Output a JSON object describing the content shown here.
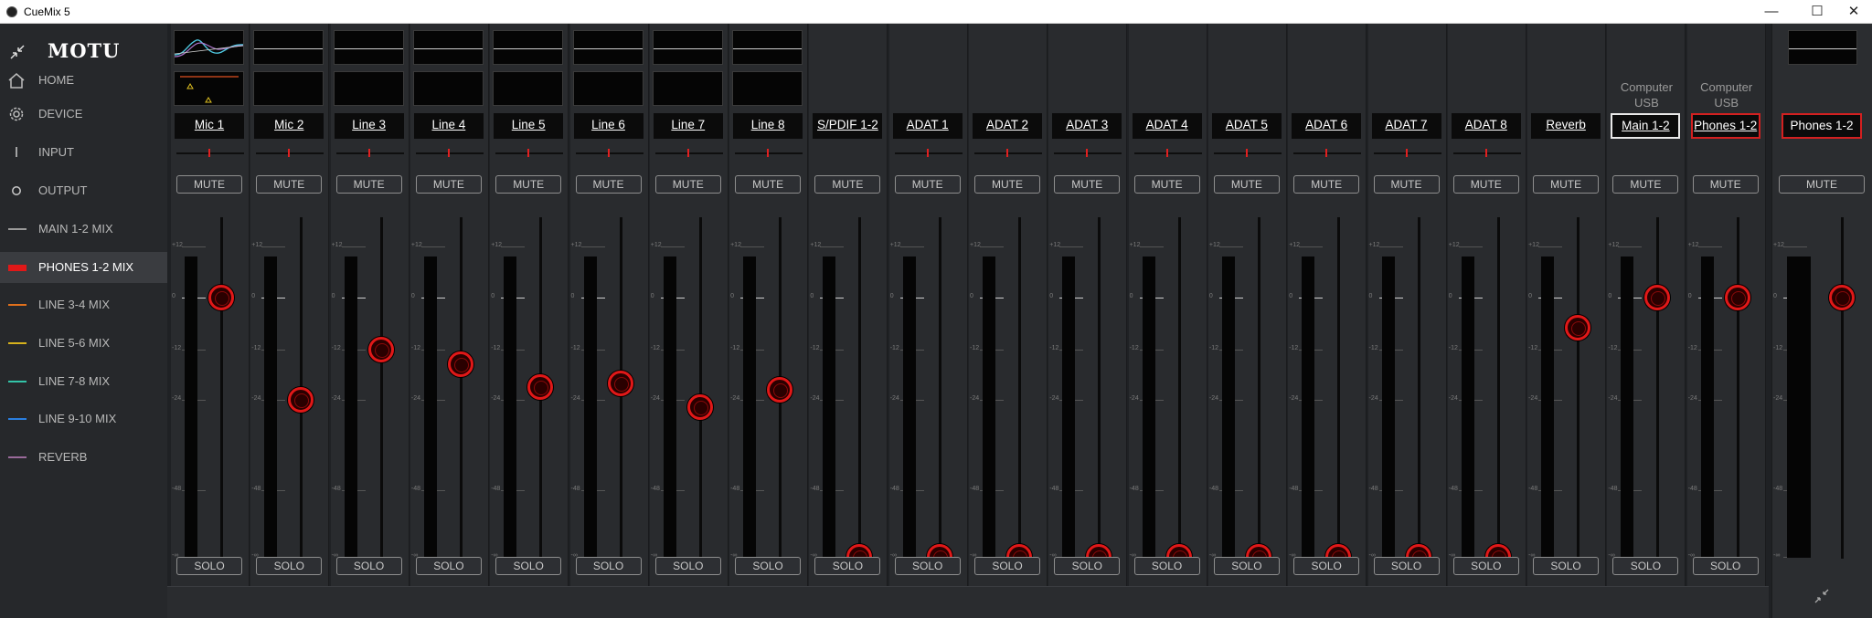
{
  "window": {
    "title": "CueMix 5",
    "minimize": "—",
    "maximize": "☐",
    "close": "✕"
  },
  "logo": "MOTU",
  "nav": [
    {
      "label": "HOME",
      "icon": "home-icon"
    },
    {
      "label": "DEVICE",
      "icon": "gear-icon"
    },
    {
      "label": "INPUT",
      "icon": "input-icon"
    },
    {
      "label": "OUTPUT",
      "icon": "output-icon"
    },
    {
      "label": "MAIN 1-2 MIX",
      "color": "#9a9a9a"
    },
    {
      "label": "PHONES 1-2 MIX",
      "color": "#e01818",
      "active": true
    },
    {
      "label": "LINE 3-4 MIX",
      "color": "#e0701c"
    },
    {
      "label": "LINE 5-6 MIX",
      "color": "#d6b21c"
    },
    {
      "label": "LINE 7-8 MIX",
      "color": "#33c4a8"
    },
    {
      "label": "LINE 9-10 MIX",
      "color": "#2a7fe0"
    },
    {
      "label": "REVERB",
      "color": "#9a6a9a"
    }
  ],
  "scale_labels": [
    "+12",
    "0",
    "-12",
    "-24",
    "-48",
    "-∞"
  ],
  "mute_label": "MUTE",
  "solo_label": "SOLO",
  "channels": [
    {
      "name": "Mic 1",
      "fader_db": 0
    },
    {
      "name": "Mic 2",
      "fader_db": -24
    },
    {
      "name": "Line 3",
      "fader_db": -12
    },
    {
      "name": "Line 4",
      "fader_db": -15.5
    },
    {
      "name": "Line 5",
      "fader_db": -21
    },
    {
      "name": "Line 6",
      "fader_db": -20
    },
    {
      "name": "Line 7",
      "fader_db": -26
    },
    {
      "name": "Line 8",
      "fader_db": -21.5
    },
    {
      "name": "S/PDIF 1-2",
      "fader_db": "-inf"
    },
    {
      "name": "ADAT 1",
      "fader_db": "-inf"
    },
    {
      "name": "ADAT 2",
      "fader_db": "-inf"
    },
    {
      "name": "ADAT 3",
      "fader_db": "-inf"
    },
    {
      "name": "ADAT 4",
      "fader_db": "-inf"
    },
    {
      "name": "ADAT 5",
      "fader_db": "-inf"
    },
    {
      "name": "ADAT 6",
      "fader_db": "-inf"
    },
    {
      "name": "ADAT 7",
      "fader_db": "-inf"
    },
    {
      "name": "ADAT 8",
      "fader_db": "-inf"
    },
    {
      "name": "Reverb",
      "fader_db": -7
    },
    {
      "name": "Main 1-2",
      "fader_db": 0,
      "source": "Computer USB",
      "border": "#e8e8e8"
    },
    {
      "name": "Phones 1-2",
      "fader_db": 0,
      "source": "Computer USB",
      "border": "#d32020"
    }
  ],
  "output_channel": {
    "name": "Phones 1-2",
    "fader_db": 0
  }
}
